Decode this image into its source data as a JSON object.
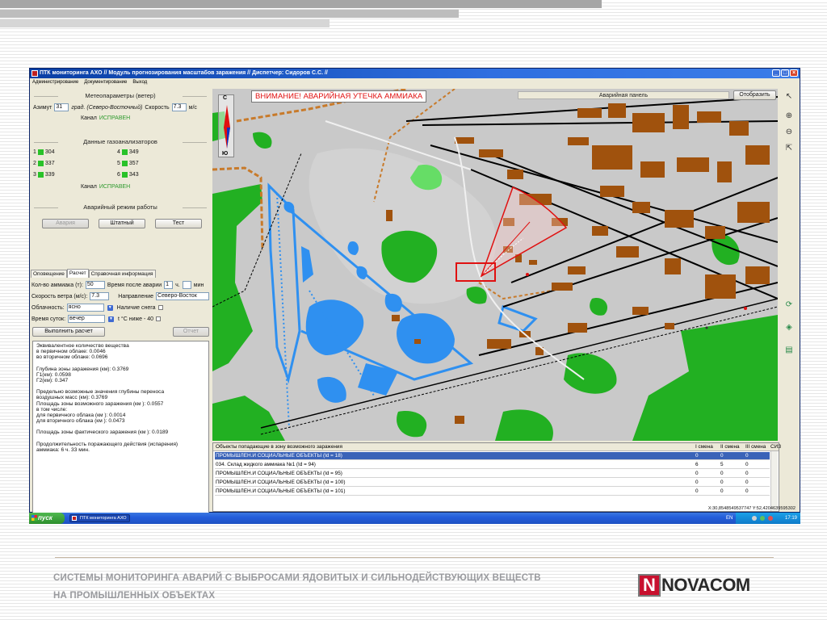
{
  "window": {
    "title": "ПТК мониторинга АХО // Модуль прогнозирования масштабов заражения // Диспетчер: Сидоров С.С. //",
    "menu": [
      "Администрирование",
      "Документирование",
      "Выход"
    ]
  },
  "meteo": {
    "title": "Метеопараметры (ветер)",
    "azimuth_label": "Азимут",
    "azimuth_value": "31",
    "azimuth_unit": "град. (Северо-Восточный)",
    "speed_label": "Скорость",
    "speed_value": "7.3",
    "speed_unit": "м/с",
    "channel_label": "Канал",
    "channel_status": "ИСПРАВЕН"
  },
  "gas": {
    "title": "Данные газоанализаторов",
    "sensors": [
      {
        "id": "1",
        "value": "304"
      },
      {
        "id": "2",
        "value": "337"
      },
      {
        "id": "3",
        "value": "339"
      },
      {
        "id": "4",
        "value": "349"
      },
      {
        "id": "5",
        "value": "357"
      },
      {
        "id": "6",
        "value": "343"
      }
    ],
    "channel_label": "Канал",
    "channel_status": "ИСПРАВЕН"
  },
  "mode": {
    "title": "Аварийный режим работы",
    "buttons": [
      "Авария",
      "Штатный",
      "Тест"
    ]
  },
  "tabs": [
    "Оповещение",
    "Расчет",
    "Справочная информация"
  ],
  "calc": {
    "ammonia_label": "Кол-во аммиака (т):",
    "ammonia_value": "50",
    "time_after_label": "Время после аварии",
    "time_after_value": "1",
    "time_after_h": "ч.",
    "time_after_min_unit": "мин",
    "wind_label": "Скорость ветра (м/с):",
    "wind_value": "7.3",
    "direction_label": "Направление",
    "direction_value": "Северо-Восток",
    "cloud_label": "Облачность:",
    "cloud_value": "ясно",
    "snow_label": "Наличие снега",
    "daytime_label": "Время суток:",
    "daytime_value": "вечер",
    "temp_label": "t °C ниже - 40",
    "run_button": "Выполнить расчет",
    "report_button": "Отчет"
  },
  "results": [
    "Эквивалентное количество вещества",
    "в первичном облаке: 0.0046",
    "во вторичном облаке: 0.0696",
    "",
    "Глубина зоны заражения (км): 0.3769",
    "Г1(км): 0.0598",
    "Г2(км): 0.347",
    "",
    "Предельно возможные значения глубины переноса",
    "воздушных масс (км): 0.3769",
    "Площадь зоны возможного заражения (км ): 0.0557",
    "в том числе:",
    "для первичного облака (км ): 0.0014",
    "для вторичного облака (км ): 0.0473",
    "",
    "Площадь зоны фактического заражения (км ): 0.0189",
    "",
    "Продолжительность поражающего действия (испарения)",
    "аммиака: 6 ч. 33 мин."
  ],
  "map": {
    "alert": "ВНИМАНИЕ! АВАРИЙНАЯ УТЕЧКА АММИАКА",
    "panel_label": "Аварийная панель",
    "show_button": "Отобразить",
    "compass_n": "С",
    "compass_s": "Ю"
  },
  "objects": {
    "title": "Объекты попадающие в зону возможного заражения",
    "columns": [
      "I смена",
      "II смена",
      "III смена",
      "СИЗ"
    ],
    "rows": [
      {
        "name": "ПРОМЫШЛЕН.И СОЦИАЛЬНЫЕ ОБЪЕКТЫ (Id = 18)",
        "c1": "0",
        "c2": "0",
        "c3": "0",
        "c4": "0"
      },
      {
        "name": "034. Склад жидкого аммиака №1 (Id = 94)",
        "c1": "6",
        "c2": "5",
        "c3": "0",
        "c4": "5"
      },
      {
        "name": "ПРОМЫШЛЕН.И СОЦИАЛЬНЫЕ ОБЪЕКТЫ (Id = 95)",
        "c1": "0",
        "c2": "0",
        "c3": "0",
        "c4": "0"
      },
      {
        "name": "ПРОМЫШЛЕН.И СОЦИАЛЬНЫЕ ОБЪЕКТЫ (Id = 100)",
        "c1": "0",
        "c2": "0",
        "c3": "0",
        "c4": "0"
      },
      {
        "name": "ПРОМЫШЛЕН.И СОЦИАЛЬНЫЕ ОБЪЕКТЫ (Id = 101)",
        "c1": "0",
        "c2": "0",
        "c3": "0",
        "c4": "0"
      }
    ]
  },
  "status_coords": "X:30,8548549537747 Y:52,4204639595302",
  "taskbar": {
    "start": "пуск",
    "task": "ПТК мониторинга АХО",
    "lang": "EN",
    "clock": "17:19"
  },
  "footer": {
    "line1": "СИСТЕМЫ МОНИТОРИНГА АВАРИЙ С ВЫБРОСАМИ ЯДОВИТЫХ И СИЛЬНОДЕЙСТВУЮЩИХ ВЕЩЕСТВ",
    "line2": "НА ПРОМЫШЛЕННЫХ ОБЪЕКТАХ",
    "logo_mark": "N",
    "logo_word": "NOVACOM"
  },
  "colors": {
    "alert": "#e01010",
    "status_ok": "#2e9a2e",
    "building": "#a0520d",
    "forest": "#22b022",
    "water": "#2f90f0",
    "selection": "#3a63b8"
  }
}
